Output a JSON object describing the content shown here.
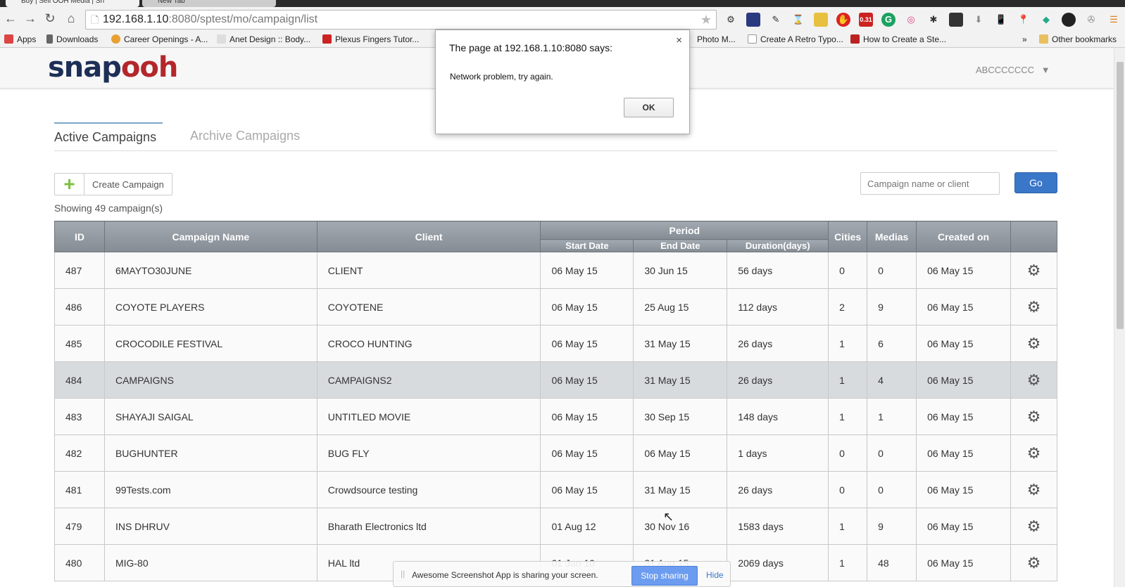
{
  "browser": {
    "tabs": [
      "Buy | Sell OOH Media | Sn",
      "New Tab"
    ],
    "url_host": "192.168.1.10",
    "url_path": ":8080/sptest/mo/campaign/list",
    "ext_badge": "0.31",
    "bookmarks": [
      "Apps",
      "Downloads",
      "Career Openings - A...",
      "Anet Design :: Body...",
      "Plexus Fingers Tutor...",
      "Photo M...",
      "Create A Retro Typo...",
      "How to Create a Ste...",
      "»",
      "Other bookmarks"
    ]
  },
  "header": {
    "logo_a": "snap",
    "logo_b": "ooh",
    "user": "ABCCCCCCC"
  },
  "tabs": {
    "active": "Active Campaigns",
    "archive": "Archive Campaigns"
  },
  "toolbar": {
    "create": "Create Campaign",
    "search_placeholder": "Campaign name or client",
    "go": "Go",
    "showing": "Showing 49 campaign(s)"
  },
  "table": {
    "headers": {
      "id": "ID",
      "name": "Campaign Name",
      "client": "Client",
      "period": "Period",
      "start": "Start Date",
      "end": "End Date",
      "duration": "Duration(days)",
      "cities": "Cities",
      "medias": "Medias",
      "created": "Created on"
    },
    "rows": [
      [
        "487",
        "6MAYTO30JUNE",
        "CLIENT",
        "06 May 15",
        "30 Jun 15",
        "56 days",
        "0",
        "0",
        "06 May 15"
      ],
      [
        "486",
        "COYOTE PLAYERS",
        "COYOTENE",
        "06 May 15",
        "25 Aug 15",
        "112 days",
        "2",
        "9",
        "06 May 15"
      ],
      [
        "485",
        "CROCODILE FESTIVAL",
        "CROCO HUNTING",
        "06 May 15",
        "31 May 15",
        "26 days",
        "1",
        "6",
        "06 May 15"
      ],
      [
        "484",
        "CAMPAIGNS",
        "CAMPAIGNS2",
        "06 May 15",
        "31 May 15",
        "26 days",
        "1",
        "4",
        "06 May 15"
      ],
      [
        "483",
        "SHAYAJI SAIGAL",
        "UNTITLED MOVIE",
        "06 May 15",
        "30 Sep 15",
        "148 days",
        "1",
        "1",
        "06 May 15"
      ],
      [
        "482",
        "BUGHUNTER",
        "BUG FLY",
        "06 May 15",
        "06 May 15",
        "1 days",
        "0",
        "0",
        "06 May 15"
      ],
      [
        "481",
        "99Tests.com",
        "Crowdsource testing",
        "06 May 15",
        "31 May 15",
        "26 days",
        "0",
        "0",
        "06 May 15"
      ],
      [
        "479",
        "INS DHRUV",
        "Bharath Electronics ltd",
        "01 Aug 12",
        "30 Nov 16",
        "1583 days",
        "1",
        "9",
        "06 May 15"
      ],
      [
        "480",
        "MIG-80",
        "HAL ltd",
        "01 Jan 10",
        "31 Aug 15",
        "2069 days",
        "1",
        "48",
        "06 May 15"
      ]
    ],
    "highlighted_row": 3
  },
  "dialog": {
    "title": "The page at 192.168.1.10:8080 says:",
    "message": "Network problem, try again.",
    "ok": "OK",
    "close": "×"
  },
  "share_bar": {
    "message": "Awesome Screenshot App is sharing your screen.",
    "stop": "Stop sharing",
    "hide": "Hide"
  }
}
